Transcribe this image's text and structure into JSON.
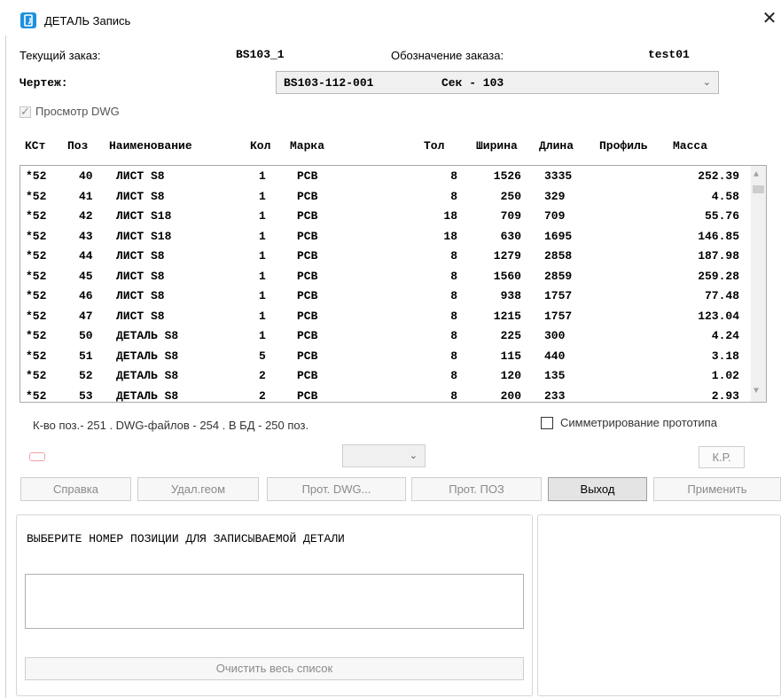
{
  "window": {
    "title": "ДЕТАЛЬ Запись",
    "close_glyph": "✕"
  },
  "info": {
    "current_order_label": "Текущий заказ:",
    "current_order_value": "BS103_1",
    "order_designation_label": "Обозначение заказа:",
    "order_designation_value": "test01",
    "drawing_label": "Чертеж:",
    "drawing_value": "BS103-112-001",
    "drawing_section": "Сек - 103"
  },
  "preview_dwg": {
    "label": "Просмотр DWG",
    "checked": true
  },
  "table": {
    "columns": [
      "КСт",
      "Поз",
      "Наименование",
      "Кол",
      "Марка",
      "Тол",
      "Ширина",
      "Длина",
      "Профиль",
      "Масса"
    ],
    "rows": [
      [
        "*52",
        "40",
        "ЛИСТ S8",
        "1",
        "PCB",
        "8",
        "1526",
        "3335",
        "",
        "252.39"
      ],
      [
        "*52",
        "41",
        "ЛИСТ S8",
        "1",
        "PCB",
        "8",
        "250",
        "329",
        "",
        "4.58"
      ],
      [
        "*52",
        "42",
        "ЛИСТ S18",
        "1",
        "PCB",
        "18",
        "709",
        "709",
        "",
        "55.76"
      ],
      [
        "*52",
        "43",
        "ЛИСТ S18",
        "1",
        "PCB",
        "18",
        "630",
        "1695",
        "",
        "146.85"
      ],
      [
        "*52",
        "44",
        "ЛИСТ S8",
        "1",
        "PCB",
        "8",
        "1279",
        "2858",
        "",
        "187.98"
      ],
      [
        "*52",
        "45",
        "ЛИСТ S8",
        "1",
        "PCB",
        "8",
        "1560",
        "2859",
        "",
        "259.28"
      ],
      [
        "*52",
        "46",
        "ЛИСТ S8",
        "1",
        "PCB",
        "8",
        "938",
        "1757",
        "",
        "77.48"
      ],
      [
        "*52",
        "47",
        "ЛИСТ S8",
        "1",
        "PCB",
        "8",
        "1215",
        "1757",
        "",
        "123.04"
      ],
      [
        "*52",
        "50",
        "ДЕТАЛЬ S8",
        "1",
        "PCB",
        "8",
        "225",
        "300",
        "",
        "4.24"
      ],
      [
        "*52",
        "51",
        "ДЕТАЛЬ S8",
        "5",
        "PCB",
        "8",
        "115",
        "440",
        "",
        "3.18"
      ],
      [
        "*52",
        "52",
        "ДЕТАЛЬ S8",
        "2",
        "PCB",
        "8",
        "120",
        "135",
        "",
        "1.02"
      ],
      [
        "*52",
        "53",
        "ДЕТАЛЬ S8",
        "2",
        "PCB",
        "8",
        "200",
        "233",
        "",
        "2.93"
      ]
    ]
  },
  "status": {
    "summary": "К-во поз.- 251 . DWG-файлов - 254 .   В БД - 250 поз.",
    "symmetry_label": "Симметрирование прототипа",
    "symmetry_checked": false
  },
  "controls": {
    "kr_label": "К.Р."
  },
  "buttons": {
    "help": "Справка",
    "delete_geom": "Удал.геом",
    "prot_dwg": "Прот. DWG...",
    "prot_poz": "Прот. ПОЗ",
    "exit": "Выход",
    "apply": "Применить"
  },
  "bottom": {
    "prompt": "ВЫБЕРИТЕ НОМЕР ПОЗИЦИИ ДЛЯ ЗАПИСЫВАЕМОЙ ДЕТАЛИ",
    "position_value": "",
    "clear_all": "Очистить весь список"
  },
  "icons": {
    "app": "app-window-icon",
    "close": "close-icon",
    "dropdown": "chevron-down-icon",
    "scroll_up": "scroll-up-arrow-icon",
    "scroll_down": "scroll-down-arrow-icon",
    "check": "checkmark-icon"
  },
  "colors": {
    "app_icon": "#1e90e0",
    "indicator_border": "#f3a0a6",
    "disabled_text": "#8a8a8a"
  }
}
